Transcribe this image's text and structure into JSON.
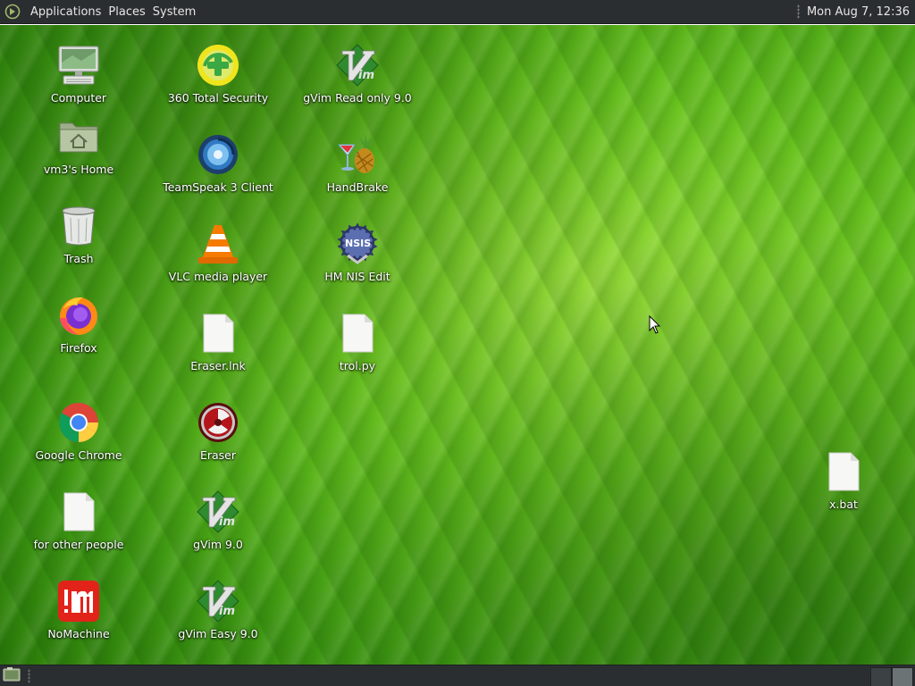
{
  "top_panel": {
    "menus": [
      "Applications",
      "Places",
      "System"
    ],
    "clock": "Mon Aug 7, 12:36"
  },
  "desktop": {
    "icons": [
      {
        "label": "Computer",
        "icon": "computer-icon"
      },
      {
        "label": "vm3's Home",
        "icon": "home-folder-icon"
      },
      {
        "label": "Trash",
        "icon": "trash-icon"
      },
      {
        "label": "Firefox",
        "icon": "firefox-icon"
      },
      {
        "label": "Google Chrome",
        "icon": "chrome-icon"
      },
      {
        "label": "for other people",
        "icon": "document-icon"
      },
      {
        "label": "NoMachine",
        "icon": "nomachine-icon"
      },
      {
        "label": "360 Total Security",
        "icon": "360-security-icon"
      },
      {
        "label": "TeamSpeak 3 Client",
        "icon": "teamspeak-icon"
      },
      {
        "label": "VLC media player",
        "icon": "vlc-icon"
      },
      {
        "label": "Eraser.lnk",
        "icon": "document-icon"
      },
      {
        "label": "Eraser",
        "icon": "eraser-icon"
      },
      {
        "label": "gVim 9.0",
        "icon": "vim-icon"
      },
      {
        "label": "gVim Easy 9.0",
        "icon": "vim-icon"
      },
      {
        "label": "gVim Read only 9.0",
        "icon": "vim-icon"
      },
      {
        "label": "HandBrake",
        "icon": "handbrake-icon"
      },
      {
        "label": "HM NIS Edit",
        "icon": "nsis-icon"
      },
      {
        "label": "trol.py",
        "icon": "document-icon"
      },
      {
        "label": "x.bat",
        "icon": "document-icon"
      }
    ]
  },
  "bottom_panel": {
    "workspaces": 2,
    "active_workspace": 1
  },
  "colors": {
    "panel": "#2b2e30",
    "desktop_green": "#6ac51f"
  }
}
